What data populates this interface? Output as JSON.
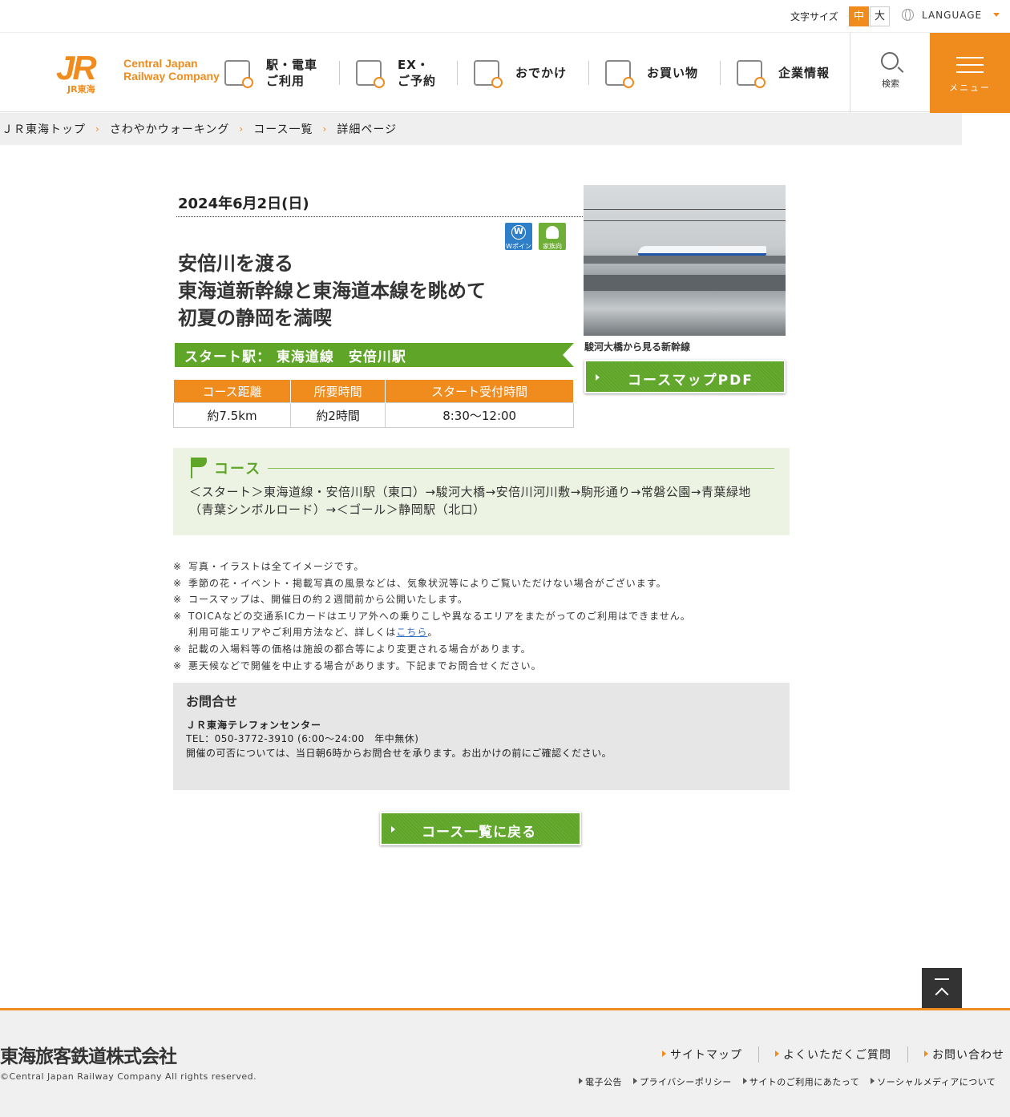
{
  "util": {
    "font_size_label": "文字サイズ",
    "font_size_options": [
      "中",
      "大"
    ],
    "language_label": "LANGUAGE"
  },
  "header": {
    "logo_mark": "JR",
    "logo_sub": "JR東海",
    "logo_line1": "Central Japan",
    "logo_line2": "Railway Company",
    "nav": [
      {
        "label": "駅・電車\nご利用",
        "icon": "train-icon"
      },
      {
        "label": "EX・\nご予約",
        "icon": "ticket-icon"
      },
      {
        "label": "おでかけ",
        "icon": "suitcase-icon"
      },
      {
        "label": "お買い物",
        "icon": "shopping-bag-icon"
      },
      {
        "label": "企業情報",
        "icon": "building-icon"
      }
    ],
    "search_label": "検索",
    "menu_label": "メニュー"
  },
  "breadcrumb": [
    "ＪＲ東海トップ",
    "さわやかウォーキング",
    "コース一覧",
    "詳細ページ"
  ],
  "event": {
    "date": "2024年6月2日(日)",
    "badges": [
      "Wポイント",
      "家族向"
    ],
    "title_lines": [
      "安倍川を渡る",
      "東海道新幹線と東海道本線を眺めて",
      "初夏の静岡を満喫"
    ],
    "start_station": "スタート駅：  東海道線　安倍川駅",
    "stats_headers": [
      "コース距離",
      "所要時間",
      "スタート受付時間"
    ],
    "stats_values": [
      "約7.5km",
      "約2時間",
      "8:30〜12:00"
    ],
    "photo_caption": "駿河大橋から見る新幹線",
    "pdf_button": "コースマップPDF"
  },
  "course": {
    "heading": "コース",
    "route": "＜スタート＞東海道線・安倍川駅（東口）→駿河大橋→安倍川河川敷→駒形通り→常磐公園→青葉緑地（青葉シンボルロード）→＜ゴール＞静岡駅（北口）"
  },
  "notes": {
    "mark": "※",
    "items": [
      "写真・イラストは全てイメージです。",
      "季節の花・イベント・掲載写真の風景などは、気象状況等によりご覧いただけない場合がございます。",
      "コースマップは、開催日の約２週間前から公開いたします。",
      "TOICAなどの交通系ICカードはエリア外への乗りこしや異なるエリアをまたがってのご利用はできません。"
    ],
    "toica_cont": "利用可能エリアやご利用方法など、詳しくは",
    "toica_link": "こちら",
    "toica_end": "。",
    "items2": [
      "記載の入場料等の価格は施設の都合等により変更される場合があります。",
      "悪天候などで開催を中止する場合があります。下記までお問合せください。"
    ]
  },
  "contact": {
    "heading": "お問合せ",
    "name": "ＪＲ東海テレフォンセンター",
    "tel": "TEL：050-3772-3910 (6:00〜24:00　年中無休)",
    "note": "開催の可否については、当日朝6時からお問合せを承ります。お出かけの前にご確認ください。"
  },
  "back_button": "コース一覧に戻る",
  "footer": {
    "company": "東海旅客鉄道株式会社",
    "copyright": "©Central Japan Railway Company All rights reserved.",
    "links_main": [
      "サイトマップ",
      "よくいただくご質問",
      "お問い合わせ"
    ],
    "links_sub": [
      "電子公告",
      "プライバシーポリシー",
      "サイトのご利用にあたって",
      "ソーシャルメディアについて"
    ]
  },
  "colors": {
    "accent": "#f08c1e",
    "green": "#5ea528",
    "course_bg": "#edf3e2"
  }
}
